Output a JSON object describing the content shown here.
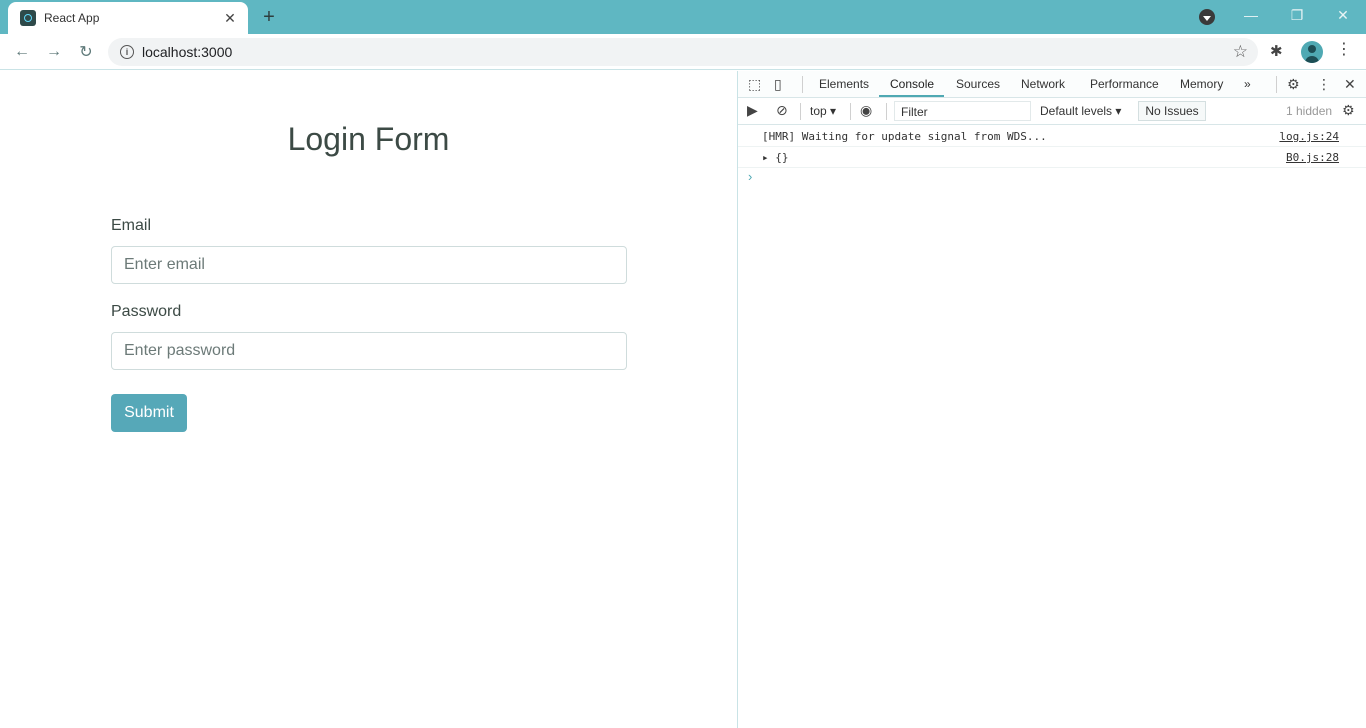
{
  "browser": {
    "tab_title": "React App",
    "tab_close": "✕",
    "new_tab": "+",
    "url": "localhost:3000",
    "icons": {
      "back": "←",
      "forward": "→",
      "reload": "↻",
      "info": "i",
      "star": "☆",
      "extensions": "✱",
      "menu": "⋮",
      "minimize": "—",
      "restore": "❐",
      "close": "✕"
    }
  },
  "page": {
    "title": "Login Form",
    "email_label": "Email",
    "email_placeholder": "Enter email",
    "password_label": "Password",
    "password_placeholder": "Enter password",
    "submit_label": "Submit"
  },
  "devtools": {
    "tabs": [
      "Elements",
      "Console",
      "Sources",
      "Network",
      "Performance",
      "Memory"
    ],
    "active_tab": "Console",
    "more_tabs": "»",
    "context": "top ▾",
    "filter_placeholder": "Filter",
    "levels": "Default levels ▾",
    "issues": "No Issues",
    "hidden": "1 hidden",
    "logs": [
      {
        "message": "[HMR] Waiting for update signal from WDS...",
        "source": "log.js:24"
      },
      {
        "message": "▸ {}",
        "source": "B0.js:28"
      }
    ],
    "prompt": "›"
  },
  "colors": {
    "tabstrip": "#5fb7c2",
    "accent": "#56a8b8",
    "text": "#3c4a45"
  }
}
